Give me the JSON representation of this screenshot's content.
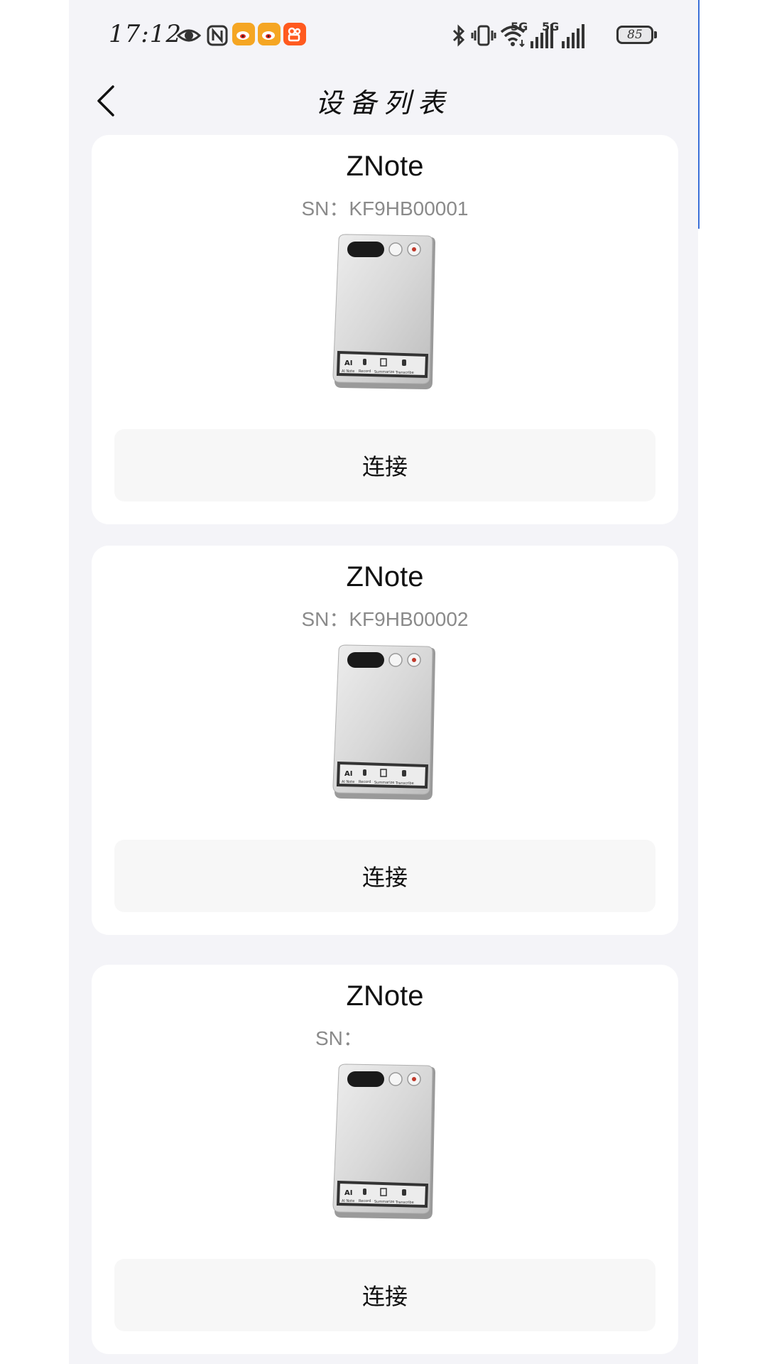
{
  "status_bar": {
    "time": "17:12",
    "net_labels": [
      "5G",
      "5G"
    ],
    "battery": "85",
    "icons": [
      "eye-icon",
      "nfc-icon",
      "weibo-icon",
      "weibo-icon",
      "kuaishou-icon",
      "bluetooth-icon",
      "vibrate-icon",
      "wifi-icon",
      "signal-icon",
      "signal-icon",
      "battery-icon"
    ]
  },
  "header": {
    "title": "设备列表",
    "back_icon": "chevron-left-icon"
  },
  "devices": [
    {
      "name": "ZNote",
      "sn": "SN：KF9HB00001",
      "button": "连接"
    },
    {
      "name": "ZNote",
      "sn": "SN：KF9HB00002",
      "button": "连接"
    },
    {
      "name": "ZNote",
      "sn": "SN：",
      "button": "连接"
    }
  ],
  "device_panel_labels": [
    "AI Note",
    "Record",
    "Summarize",
    "Transcribe"
  ],
  "colors": {
    "page_background": "#f4f4f8",
    "card_background": "#ffffff",
    "button_background": "#f7f7f7",
    "weibo": "#f5a623",
    "kuaishou": "#ff5a1f"
  }
}
